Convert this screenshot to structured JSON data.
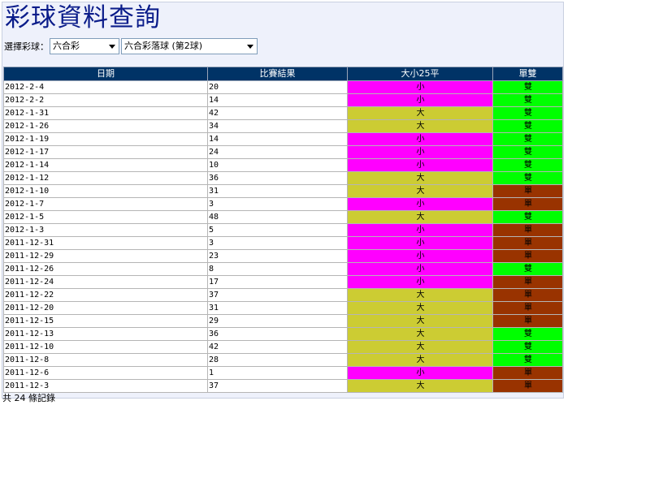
{
  "page": {
    "title": "彩球資料查詢"
  },
  "selector": {
    "label": "選擇彩球：",
    "lottery_value": "六合彩",
    "ball_value": "六合彩落球 (第2球)"
  },
  "table": {
    "headers": [
      "日期",
      "比賽結果",
      "大小25平",
      "單雙"
    ],
    "rows": [
      {
        "date": "2012-2-4",
        "result": "20",
        "size": "小",
        "parity": "雙"
      },
      {
        "date": "2012-2-2",
        "result": "14",
        "size": "小",
        "parity": "雙"
      },
      {
        "date": "2012-1-31",
        "result": "42",
        "size": "大",
        "parity": "雙"
      },
      {
        "date": "2012-1-26",
        "result": "34",
        "size": "大",
        "parity": "雙"
      },
      {
        "date": "2012-1-19",
        "result": "14",
        "size": "小",
        "parity": "雙"
      },
      {
        "date": "2012-1-17",
        "result": "24",
        "size": "小",
        "parity": "雙"
      },
      {
        "date": "2012-1-14",
        "result": "10",
        "size": "小",
        "parity": "雙"
      },
      {
        "date": "2012-1-12",
        "result": "36",
        "size": "大",
        "parity": "雙"
      },
      {
        "date": "2012-1-10",
        "result": "31",
        "size": "大",
        "parity": "單"
      },
      {
        "date": "2012-1-7",
        "result": "3",
        "size": "小",
        "parity": "單"
      },
      {
        "date": "2012-1-5",
        "result": "48",
        "size": "大",
        "parity": "雙"
      },
      {
        "date": "2012-1-3",
        "result": "5",
        "size": "小",
        "parity": "單"
      },
      {
        "date": "2011-12-31",
        "result": "3",
        "size": "小",
        "parity": "單"
      },
      {
        "date": "2011-12-29",
        "result": "23",
        "size": "小",
        "parity": "單"
      },
      {
        "date": "2011-12-26",
        "result": "8",
        "size": "小",
        "parity": "雙"
      },
      {
        "date": "2011-12-24",
        "result": "17",
        "size": "小",
        "parity": "單"
      },
      {
        "date": "2011-12-22",
        "result": "37",
        "size": "大",
        "parity": "單"
      },
      {
        "date": "2011-12-20",
        "result": "31",
        "size": "大",
        "parity": "單"
      },
      {
        "date": "2011-12-15",
        "result": "29",
        "size": "大",
        "parity": "單"
      },
      {
        "date": "2011-12-13",
        "result": "36",
        "size": "大",
        "parity": "雙"
      },
      {
        "date": "2011-12-10",
        "result": "42",
        "size": "大",
        "parity": "雙"
      },
      {
        "date": "2011-12-8",
        "result": "28",
        "size": "大",
        "parity": "雙"
      },
      {
        "date": "2011-12-6",
        "result": "1",
        "size": "小",
        "parity": "單"
      },
      {
        "date": "2011-12-3",
        "result": "37",
        "size": "大",
        "parity": "單"
      }
    ]
  },
  "footer": {
    "text": "共 24 條記錄"
  },
  "colors": {
    "small": "#ff00ff",
    "big": "#cccc33",
    "even": "#00ff00",
    "odd": "#993300",
    "header_bg": "#003366",
    "title": "#0a1c8a"
  }
}
